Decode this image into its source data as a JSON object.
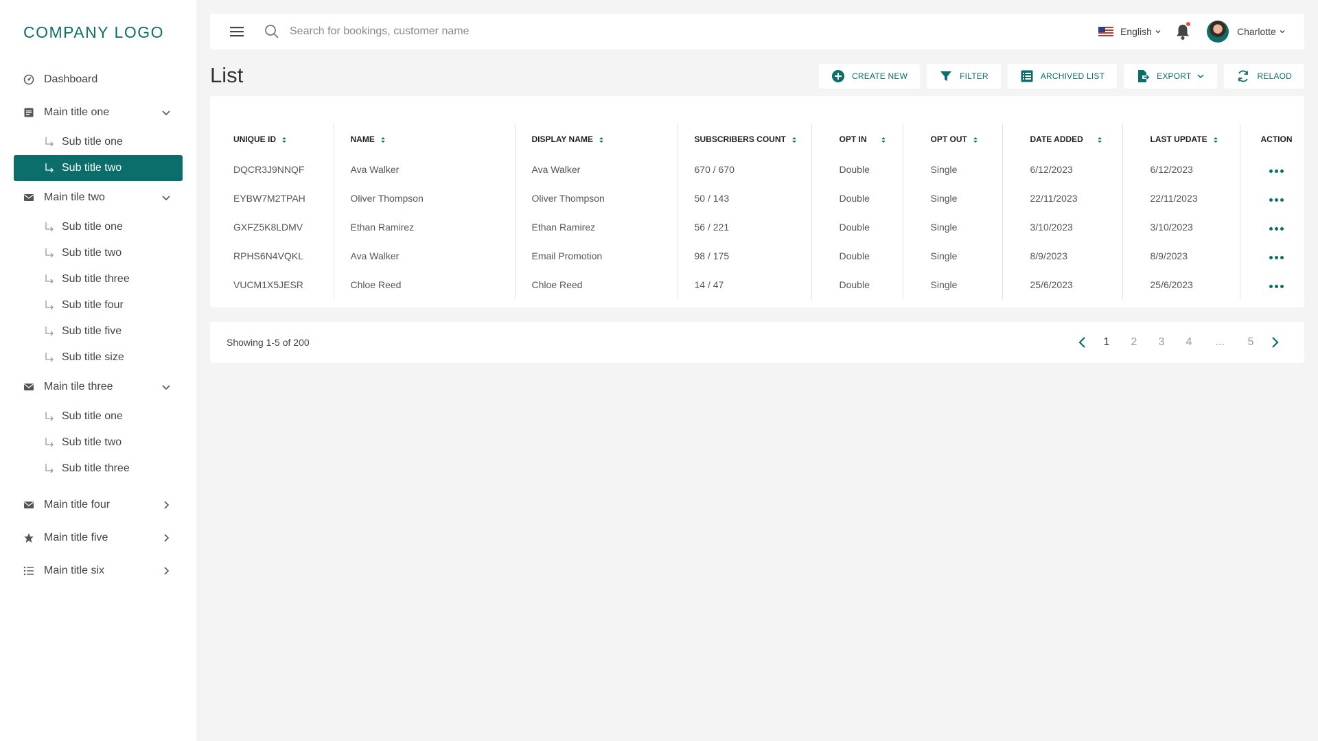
{
  "brand": {
    "logo_text": "COMPANY LOGO",
    "accent": "#0b6e6b"
  },
  "sidebar": {
    "dashboard": "Dashboard",
    "groups": [
      {
        "label": "Main title one",
        "subs": [
          "Sub title one",
          "Sub title two"
        ]
      },
      {
        "label": "Main tile two",
        "subs": [
          "Sub title one",
          "Sub title two",
          "Sub title three",
          "Sub title four",
          "Sub title five",
          "Sub title size"
        ]
      },
      {
        "label": "Main tile three",
        "subs": [
          "Sub title one",
          "Sub title two",
          "Sub title three"
        ]
      },
      {
        "label": "Main title four"
      },
      {
        "label": "Main title five"
      },
      {
        "label": "Main title six"
      }
    ],
    "active_item": "Sub title two"
  },
  "topbar": {
    "search_placeholder": "Search for bookings, customer name",
    "language": "English",
    "user_name": "Charlotte",
    "notification_dot": true
  },
  "page": {
    "title": "List",
    "actions": {
      "create": "CREATE NEW",
      "filter": "FILTER",
      "archived": "ARCHIVED LIST",
      "export": "EXPORT",
      "reload": "RELAOD"
    }
  },
  "table": {
    "headers": {
      "id": "UNIQUE ID",
      "name": "NAME",
      "display": "DISPLAY NAME",
      "subs": "SUBSCRIBERS COUNT",
      "optin": "OPT IN",
      "optout": "OPT OUT",
      "added": "DATE ADDED",
      "updated": "LAST UPDATE",
      "action": "ACTION"
    },
    "rows": [
      {
        "id": "DQCR3J9NNQF",
        "name": "Ava Walker",
        "display": "Ava Walker",
        "subs": "670 / 670",
        "optin": "Double",
        "optout": "Single",
        "added": "6/12/2023",
        "updated": "6/12/2023"
      },
      {
        "id": "EYBW7M2TPAH",
        "name": "Oliver Thompson",
        "display": "Oliver Thompson",
        "subs": "50 / 143",
        "optin": "Double",
        "optout": "Single",
        "added": "22/11/2023",
        "updated": "22/11/2023"
      },
      {
        "id": "GXFZ5K8LDMV",
        "name": "Ethan Ramirez",
        "display": "Ethan Ramirez",
        "subs": "56 / 221",
        "optin": "Double",
        "optout": "Single",
        "added": "3/10/2023",
        "updated": "3/10/2023"
      },
      {
        "id": "RPHS6N4VQKL",
        "name": "Ava Walker",
        "display": "Email Promotion",
        "subs": "98 / 175",
        "optin": "Double",
        "optout": "Single",
        "added": "8/9/2023",
        "updated": "8/9/2023"
      },
      {
        "id": "VUCM1X5JESR",
        "name": "Chloe Reed",
        "display": "Chloe Reed",
        "subs": "14 / 47",
        "optin": "Double",
        "optout": "Single",
        "added": "25/6/2023",
        "updated": "25/6/2023"
      }
    ]
  },
  "pagination": {
    "showing": "Showing 1-5 of 200",
    "pages": [
      "1",
      "2",
      "3",
      "4",
      "...",
      "5"
    ],
    "current": "1"
  }
}
